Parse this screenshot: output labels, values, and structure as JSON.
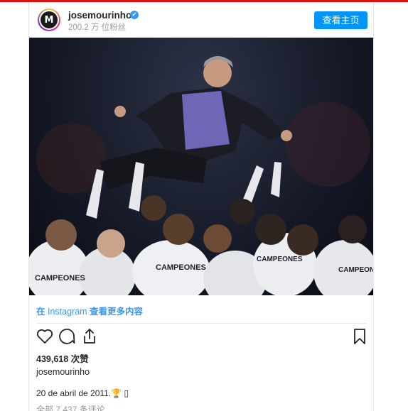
{
  "header": {
    "avatar_letter": "M",
    "username": "josemourinho",
    "verified_icon": "✔",
    "followers": "200.2 万 位粉丝",
    "view_profile": "查看主页"
  },
  "post": {
    "instagram_link_prefix": "在 ",
    "instagram_brand": "Instagram",
    "instagram_link_suffix": " 查看更多内容",
    "likes": "439,618 次赞",
    "caption_user": "josemourinho",
    "date": "20 de abril de 2011.🏆 ▯",
    "comments": "全部 7,437 条评论",
    "jersey_text": "CAMPEONES"
  },
  "colors": {
    "accent": "#0095f6",
    "link": "#3897f0",
    "top_strip": "#d90f0f"
  }
}
